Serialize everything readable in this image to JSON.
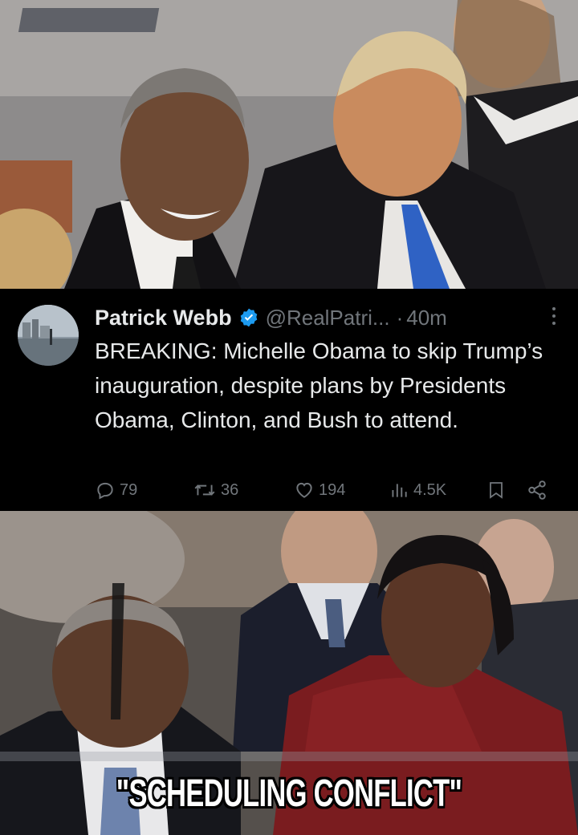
{
  "tweet": {
    "author_name": "Patrick Webb",
    "handle": "@RealPatri...",
    "separator": "·",
    "time": "40m",
    "verified_color": "#1d9bf0",
    "text": "BREAKING: Michelle Obama to skip Trump’s inauguration, despite plans by Presidents Obama, Clinton, and Bush to attend.",
    "actions": {
      "replies": "79",
      "reposts": "36",
      "likes": "194",
      "views": "4.5K"
    },
    "icons": [
      "verified-badge-icon",
      "more-options-icon",
      "reply-icon",
      "repost-icon",
      "like-icon",
      "views-icon",
      "bookmark-icon",
      "share-icon"
    ]
  },
  "meme": {
    "caption": "\"SCHEDULING CONFLICT\""
  },
  "colors": {
    "background": "#000000",
    "text_primary": "#e7e9ea",
    "text_secondary": "#71767b",
    "accent": "#1d9bf0"
  }
}
